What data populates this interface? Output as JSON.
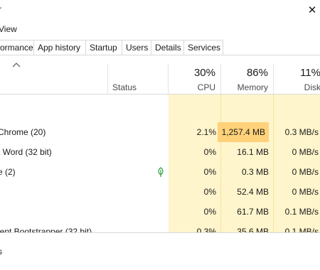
{
  "window": {
    "title": "r",
    "close_glyph": "✕"
  },
  "menu": [
    {
      "label": "View"
    }
  ],
  "tabs": [
    {
      "label": "ormance"
    },
    {
      "label": "App history"
    },
    {
      "label": "Startup"
    },
    {
      "label": "Users"
    },
    {
      "label": "Details"
    },
    {
      "label": "Services"
    }
  ],
  "columns": {
    "status": "Status",
    "cpu": {
      "pct": "30%",
      "label": "CPU"
    },
    "memory": {
      "pct": "86%",
      "label": "Memory"
    },
    "disk": {
      "pct": "11%",
      "label": "Disk"
    }
  },
  "rows": [
    {
      "name": "",
      "cpu": "",
      "memory": "",
      "disk": ""
    },
    {
      "name": "Chrome (20)",
      "cpu": "2.1%",
      "memory": "1,257.4 MB",
      "disk": "0.3 MB/s"
    },
    {
      "name": "t Word (32 bit)",
      "cpu": "0%",
      "memory": "16.1 MB",
      "disk": "0 MB/s"
    },
    {
      "name": "e (2)",
      "cpu": "0%",
      "memory": "0.3 MB",
      "disk": "0 MB/s",
      "status_icon": "leaf-icon"
    },
    {
      "name": "",
      "cpu": "0%",
      "memory": "52.4 MB",
      "disk": "0 MB/s"
    },
    {
      "name": "",
      "cpu": "0%",
      "memory": "61.7 MB",
      "disk": "0.1 MB/s"
    },
    {
      "name": "ient Bootstrapper (32 bit)",
      "cpu": "0.3%",
      "memory": "35.6 MB",
      "disk": "0.1 MB/s"
    }
  ],
  "footer": {
    "label": "s"
  },
  "colors": {
    "heat_low": "#fff5cc",
    "heat_high": "#ffd27a",
    "leaf": "#2ea043"
  },
  "icons": {
    "sort": "chevron-up-icon",
    "close": "close-icon",
    "status": "leaf-icon"
  }
}
